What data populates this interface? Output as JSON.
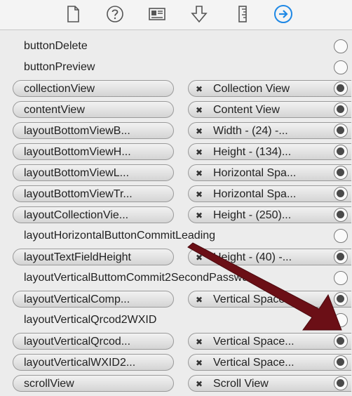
{
  "toolbar": {
    "icons": [
      "file-icon",
      "quick-help-icon",
      "identity-icon",
      "attributes-icon",
      "size-ruler-icon",
      "connections-icon"
    ],
    "active_icon": "connections-icon",
    "accent": "#1e88e5"
  },
  "outlets": [
    {
      "name": "buttonDelete",
      "connected": false
    },
    {
      "name": "buttonPreview",
      "connected": false
    },
    {
      "name": "collectionView",
      "connected": true,
      "target": "Collection View"
    },
    {
      "name": "contentView",
      "connected": true,
      "target": "Content View"
    },
    {
      "name": "layoutBottomViewB...",
      "connected": true,
      "target": "Width - (24) -..."
    },
    {
      "name": "layoutBottomViewH...",
      "connected": true,
      "target": "Height - (134)..."
    },
    {
      "name": "layoutBottomViewL...",
      "connected": true,
      "target": "Horizontal Spa..."
    },
    {
      "name": "layoutBottomViewTr...",
      "connected": true,
      "target": "Horizontal Spa..."
    },
    {
      "name": "layoutCollectionVie...",
      "connected": true,
      "target": "Height - (250)..."
    },
    {
      "name": "layoutHorizontalButtonCommitLeading",
      "connected": false
    },
    {
      "name": "layoutTextFieldHeight",
      "connected": true,
      "target": "Height - (40) -..."
    },
    {
      "name": "layoutVerticalButtomCommit2SecondPasswd",
      "connected": false
    },
    {
      "name": "layoutVerticalComp...",
      "connected": true,
      "target": "Vertical Space..."
    },
    {
      "name": "layoutVerticalQrcod2WXID",
      "connected": false
    },
    {
      "name": "layoutVerticalQrcod...",
      "connected": true,
      "target": "Vertical Space..."
    },
    {
      "name": "layoutVerticalWXID2...",
      "connected": true,
      "target": "Vertical Space..."
    },
    {
      "name": "scrollView",
      "connected": true,
      "target": "Scroll View"
    }
  ],
  "annotation": {
    "arrow_color": "#6b0f16",
    "description_icon": "red-arrow-pointer"
  }
}
